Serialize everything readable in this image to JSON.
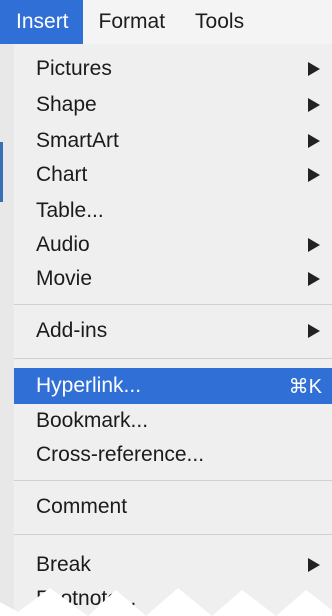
{
  "menubar": {
    "items": [
      {
        "label": "Insert"
      },
      {
        "label": "Format"
      },
      {
        "label": "Tools"
      }
    ]
  },
  "menu": {
    "items": [
      {
        "label": "Pictures",
        "submenu": true
      },
      {
        "label": "Shape",
        "submenu": true
      },
      {
        "label": "SmartArt",
        "submenu": true
      },
      {
        "label": "Chart",
        "submenu": true
      },
      {
        "label": "Table...",
        "submenu": false
      },
      {
        "label": "Audio",
        "submenu": true
      },
      {
        "label": "Movie",
        "submenu": true
      },
      {
        "label": "Add-ins",
        "submenu": true
      },
      {
        "label": "Hyperlink...",
        "shortcut": "⌘K",
        "highlighted": true
      },
      {
        "label": "Bookmark..."
      },
      {
        "label": "Cross-reference..."
      },
      {
        "label": "Comment"
      },
      {
        "label": "Break",
        "submenu": true
      },
      {
        "label": "Footnote..."
      }
    ]
  },
  "colors": {
    "highlight": "#2f6fd6",
    "menu_bg": "#efefef",
    "text": "#1b1b1b"
  }
}
